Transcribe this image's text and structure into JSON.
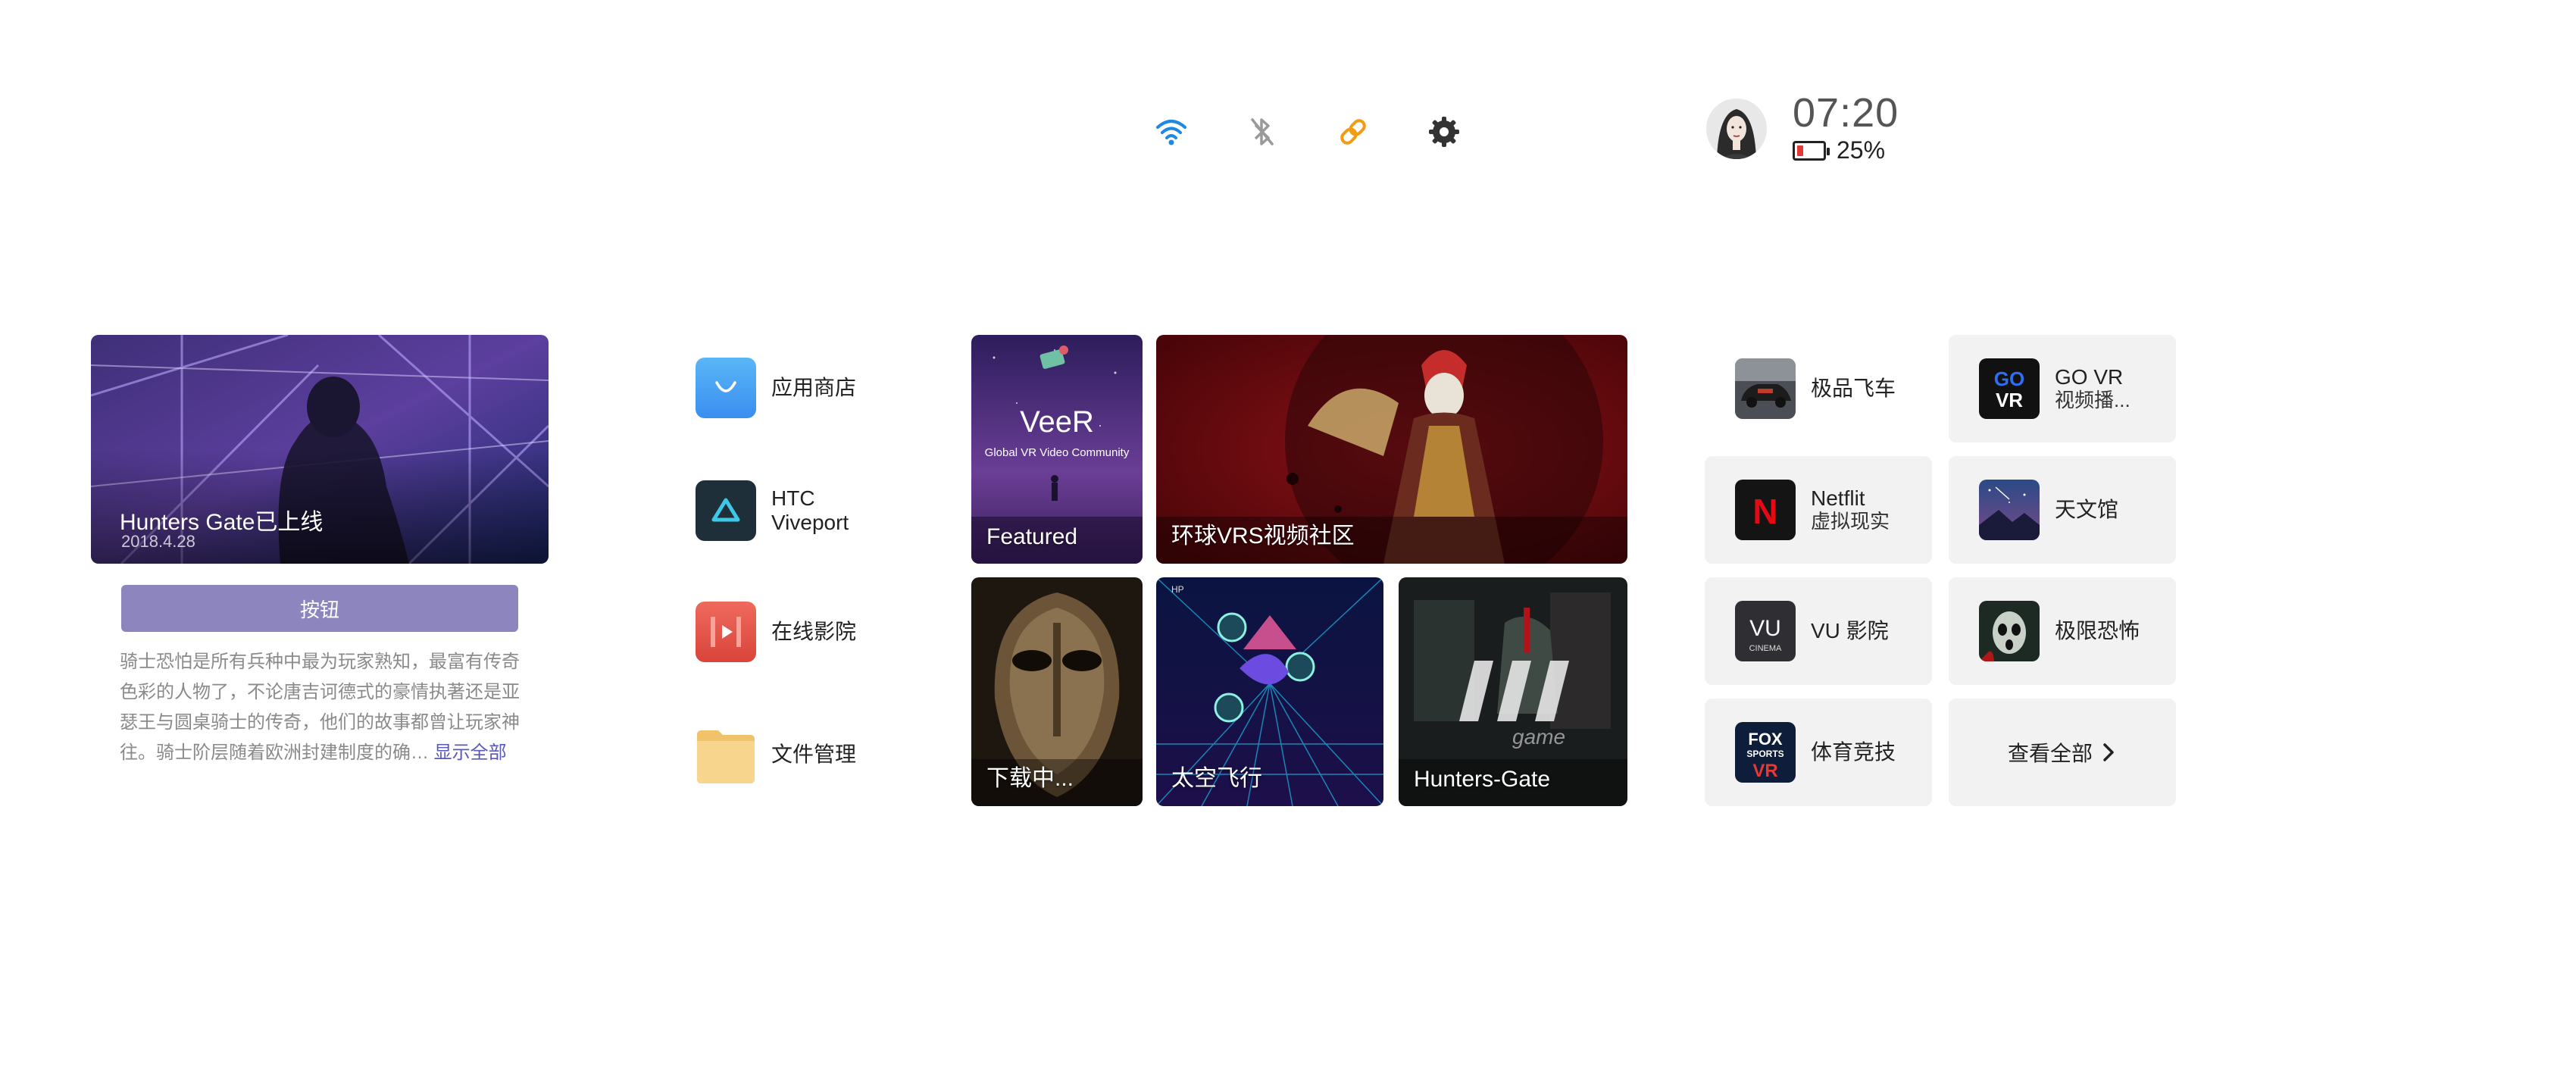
{
  "status_bar": {
    "icons": [
      "wifi-icon",
      "bluetooth-off-icon",
      "link-icon",
      "gear-icon"
    ],
    "time": "07:20",
    "battery": "25%",
    "battery_level": 0.25
  },
  "featured": {
    "title": "Hunters Gate已上线",
    "date": "2018.4.28",
    "button_label": "按钮",
    "description": "骑士恐怕是所有兵种中最为玩家熟知，最富有传奇色彩的人物了，不论唐吉诃德式的豪情执著还是亚瑟王与圆桌骑士的传奇，他们的故事都曾让玩家神往。骑士阶层随着欧洲封建制度的确…",
    "show_all": "显示全部"
  },
  "apps": [
    {
      "label": "应用商店"
    },
    {
      "label": "HTC",
      "label2": "Viveport"
    },
    {
      "label": "在线影院"
    },
    {
      "label": "文件管理"
    }
  ],
  "tiles": {
    "featured": {
      "label": "Featured",
      "logo": "VeeR",
      "tagline": "Global VR Video Community"
    },
    "vrs": {
      "label": "环球VRS视频社区"
    },
    "downloading": {
      "label": "下载中..."
    },
    "space": {
      "label": "太空飞行",
      "hud": "HP"
    },
    "hunters": {
      "label": "Hunters-Gate",
      "watermark": "game"
    }
  },
  "grid": {
    "items": [
      {
        "title": "极品飞车",
        "sub": ""
      },
      {
        "title": "GO VR",
        "sub": "视频播..."
      },
      {
        "title": "Netflit",
        "sub": "虚拟现实"
      },
      {
        "title": "天文馆",
        "sub": ""
      },
      {
        "title": "VU 影院",
        "sub": ""
      },
      {
        "title": "极限恐怖",
        "sub": ""
      },
      {
        "title": "体育竞技",
        "sub": ""
      }
    ],
    "view_all": "查看全部",
    "logos": {
      "govr_top": "GO",
      "govr_bottom": "VR",
      "netflix": "N",
      "vu": "VU",
      "vu_sub": "CINEMA",
      "fox": "FOX",
      "fox_sub": "SPORTS",
      "fox_vr": "VR"
    }
  },
  "colors": {
    "accent_button": "#8d86be",
    "link": "#5a58b8",
    "wifi": "#1e88e5",
    "link_icon": "#f39c12",
    "battery_low": "#e53935"
  }
}
